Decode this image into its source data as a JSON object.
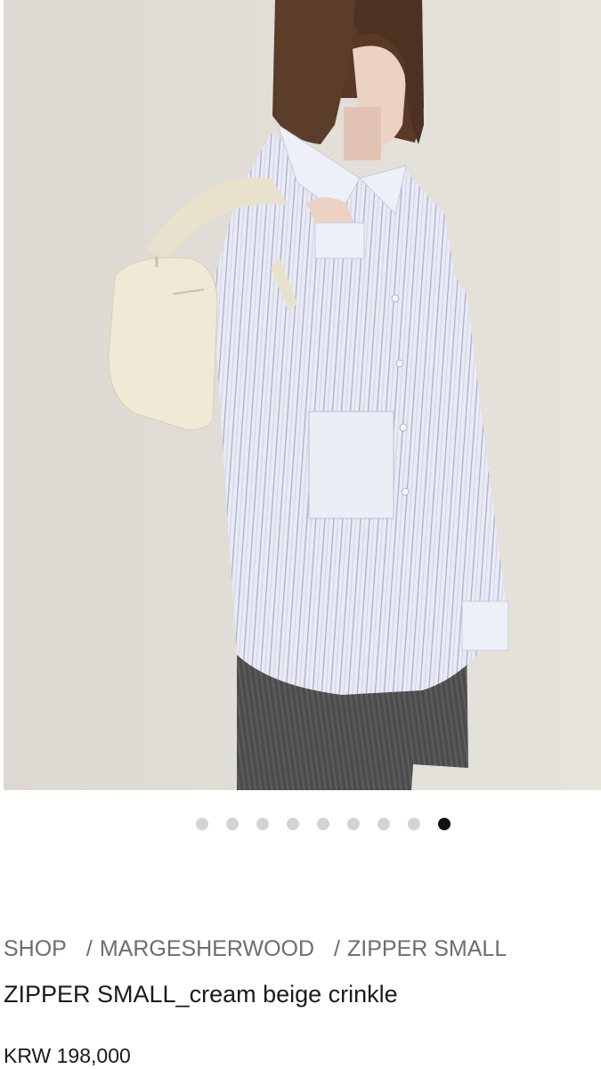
{
  "gallery": {
    "slide_count": 9,
    "active_index": 8,
    "image_alt": "Model wearing striped shirt with cream zipper bag"
  },
  "breadcrumb": {
    "items": [
      "SHOP",
      "MARGESHERWOOD",
      "ZIPPER SMALL"
    ],
    "separator": "/"
  },
  "product": {
    "title": "ZIPPER SMALL_cream beige crinkle",
    "price": "KRW 198,000"
  },
  "colors": {
    "background": "#e3e0da",
    "dot_inactive": "#d3d3d3",
    "dot_active": "#111111",
    "breadcrumb_text": "#6d6d6d"
  }
}
